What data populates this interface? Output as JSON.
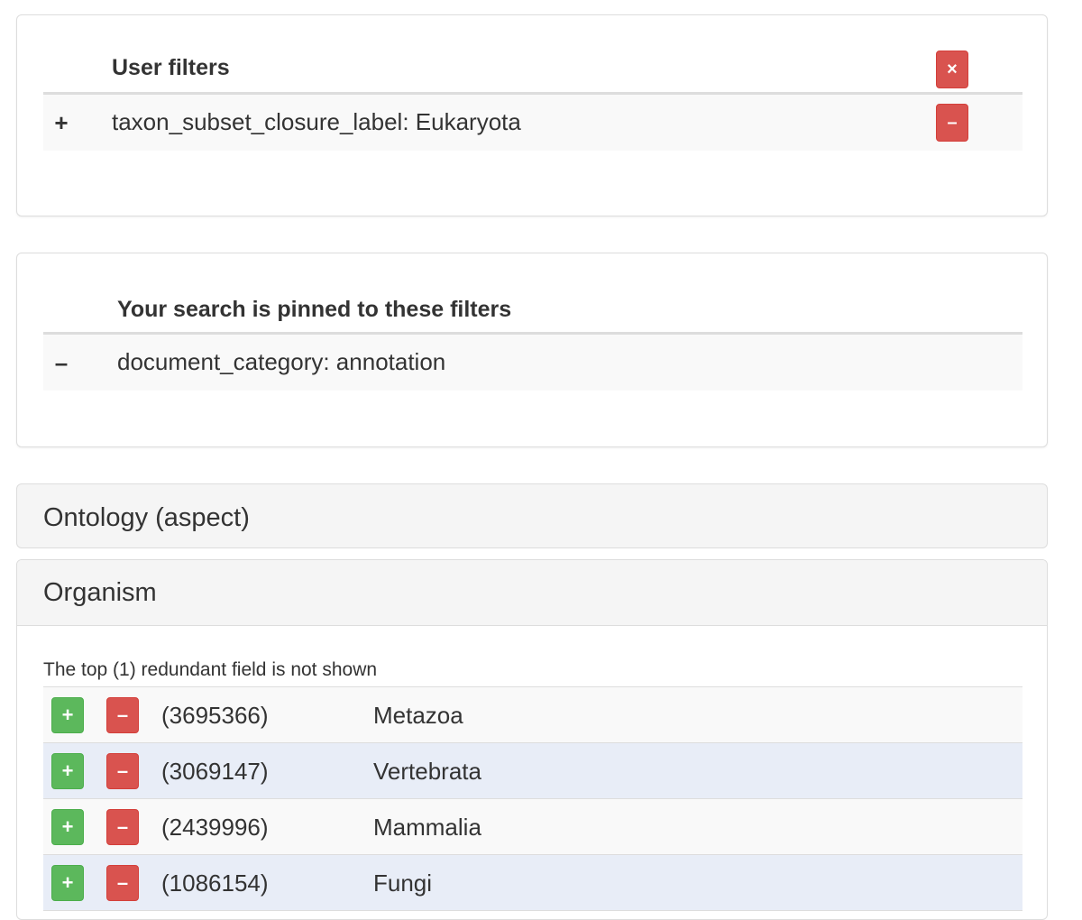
{
  "user_filters": {
    "title": "User filters",
    "clear_all_label": "×",
    "rows": [
      {
        "sign": "+",
        "value": "taxon_subset_closure_label: Eukaryota",
        "remove_label": "–"
      }
    ]
  },
  "pinned_filters": {
    "title": "Your search is pinned to these filters",
    "rows": [
      {
        "sign": "–",
        "value": "document_category: annotation"
      }
    ]
  },
  "accordions": {
    "ontology": {
      "title": "Ontology (aspect)"
    },
    "organism": {
      "title": "Organism",
      "note": "The top (1) redundant field is not shown",
      "plus_label": "+",
      "minus_label": "–",
      "rows": [
        {
          "count": "(3695366)",
          "label": "Metazoa"
        },
        {
          "count": "(3069147)",
          "label": "Vertebrata"
        },
        {
          "count": "(2439996)",
          "label": "Mammalia"
        },
        {
          "count": "(1086154)",
          "label": "Fungi"
        }
      ]
    }
  },
  "colors": {
    "danger": "#d9534f",
    "success": "#5cb85c",
    "row_highlight": "#e8edf7"
  }
}
